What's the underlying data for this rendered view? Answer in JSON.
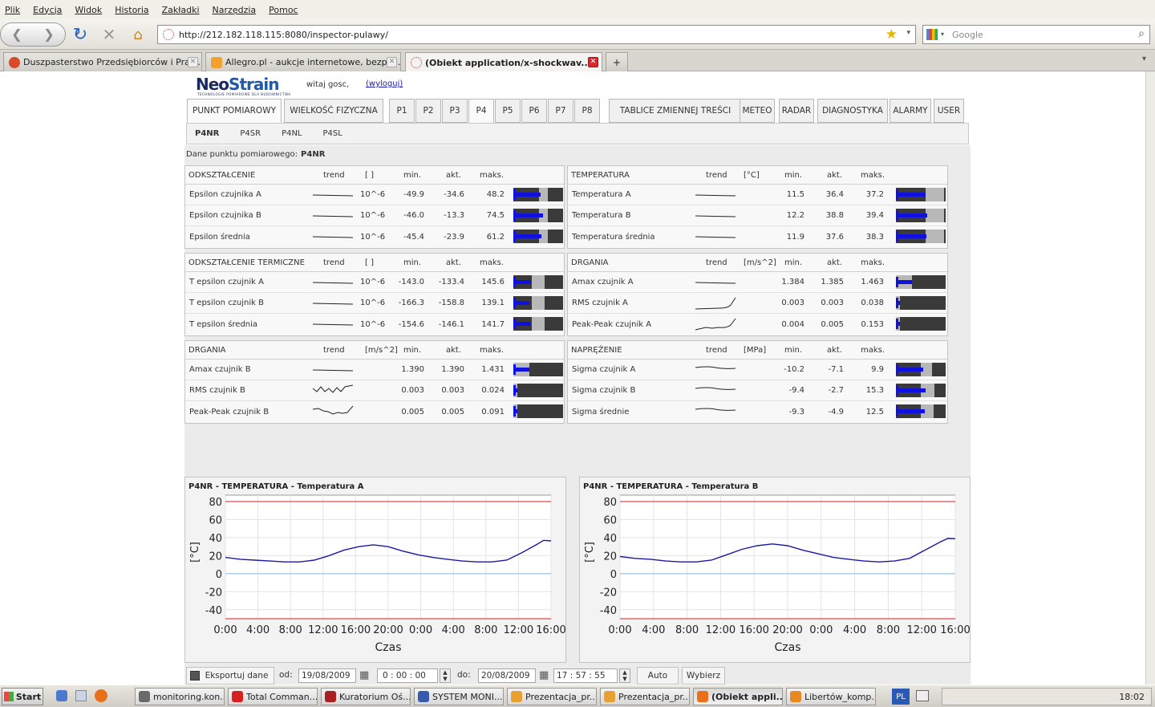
{
  "menu": [
    "Plik",
    "Edycja",
    "Widok",
    "Historia",
    "Zakładki",
    "Narzędzia",
    "Pomoc"
  ],
  "browser": {
    "url": "http://212.182.118.115:8080/inspector-pulawy/",
    "search_placeholder": "Google",
    "tabs": [
      {
        "label": "Duszpasterstwo Przedsiębiorców i Prac...",
        "active": false
      },
      {
        "label": "Allegro.pl - aukcje internetowe, bezpie...",
        "active": false
      },
      {
        "label": "(Obiekt application/x-shockwav...",
        "active": true
      }
    ]
  },
  "app": {
    "logo_neo": "Neo",
    "logo_strain": "Strain",
    "logo_sub": "TECHNOLOGIE POMIAROWE DLA BUDOWNICTWA",
    "greeting": "witaj gosc,",
    "logout": "(wyloguj)",
    "main_tabs": [
      {
        "label": "PUNKT POMIAROWY",
        "sel": true
      },
      {
        "label": "WIELKOŚĆ FIZYCZNA"
      },
      {
        "label": "P1"
      },
      {
        "label": "P2"
      },
      {
        "label": "P3"
      },
      {
        "label": "P4",
        "sel": true
      },
      {
        "label": "P5"
      },
      {
        "label": "P6"
      },
      {
        "label": "P7"
      },
      {
        "label": "P8"
      },
      {
        "label": "TABLICE ZMIENNEJ TREŚCI"
      },
      {
        "label": "METEO"
      },
      {
        "label": "RADAR"
      },
      {
        "label": "DIAGNOSTYKA"
      },
      {
        "label": "ALARMY"
      },
      {
        "label": "USER"
      }
    ],
    "sub_tabs": [
      {
        "label": "P4NR",
        "sel": true
      },
      {
        "label": "P4SR"
      },
      {
        "label": "P4NL"
      },
      {
        "label": "P4SL"
      }
    ],
    "point_label": "Dane punktu pomiarowego:",
    "point_name": "P4NR"
  },
  "panels": [
    {
      "title": "ODKSZTAŁCENIE",
      "trend": "trend",
      "unit": "[ ]",
      "min": "min.",
      "akt": "akt.",
      "maks": "maks.",
      "rows": [
        {
          "name": "Epsilon czujnika A",
          "unit": "10^-6",
          "min": "-49.9",
          "akt": "-34.6",
          "maks": "48.2",
          "range": [
            0.52,
            0.7
          ],
          "value": 0.55,
          "trend": "flat"
        },
        {
          "name": "Epsilon czujnika B",
          "unit": "10^-6",
          "min": "-46.0",
          "akt": "-13.3",
          "maks": "74.5",
          "range": [
            0.52,
            0.7
          ],
          "value": 0.6,
          "trend": "flat"
        },
        {
          "name": "Epsilon średnia",
          "unit": "10^-6",
          "min": "-45.4",
          "akt": "-23.9",
          "maks": "61.2",
          "range": [
            0.52,
            0.7
          ],
          "value": 0.57,
          "trend": "flat"
        }
      ]
    },
    {
      "title": "TEMPERATURA",
      "trend": "trend",
      "unit": "[°C]",
      "min": "min.",
      "akt": "akt.",
      "maks": "maks.",
      "rows": [
        {
          "name": "Temperatura A",
          "unit": "",
          "min": "11.5",
          "akt": "36.4",
          "maks": "37.2",
          "range": [
            0.6,
            0.97
          ],
          "value": 0.6,
          "trend": "flat"
        },
        {
          "name": "Temperatura B",
          "unit": "",
          "min": "12.2",
          "akt": "38.8",
          "maks": "39.4",
          "range": [
            0.6,
            0.97
          ],
          "value": 0.63,
          "trend": "flat"
        },
        {
          "name": "Temperatura średnia",
          "unit": "",
          "min": "11.9",
          "akt": "37.6",
          "maks": "38.3",
          "range": [
            0.6,
            0.97
          ],
          "value": 0.62,
          "trend": "flat"
        }
      ]
    },
    {
      "title": "ODKSZTAŁCENIE TERMICZNE",
      "trend": "trend",
      "unit": "[ ]",
      "min": "min.",
      "akt": "akt.",
      "maks": "maks.",
      "rows": [
        {
          "name": "T epsilon czujnik A",
          "unit": "10^-6",
          "min": "-143.0",
          "akt": "-133.4",
          "maks": "145.6",
          "range": [
            0.37,
            0.63
          ],
          "value": 0.36,
          "trend": "flat"
        },
        {
          "name": "T epsilon czujnik B",
          "unit": "10^-6",
          "min": "-166.3",
          "akt": "-158.8",
          "maks": "139.1",
          "range": [
            0.37,
            0.63
          ],
          "value": 0.32,
          "trend": "flat"
        },
        {
          "name": "T epsilon średnia",
          "unit": "10^-6",
          "min": "-154.6",
          "akt": "-146.1",
          "maks": "141.7",
          "range": [
            0.37,
            0.63
          ],
          "value": 0.34,
          "trend": "flat"
        }
      ]
    },
    {
      "title": "DRGANIA",
      "trend": "trend",
      "unit": "[m/s^2]",
      "min": "min.",
      "akt": "akt.",
      "maks": "maks.",
      "rows": [
        {
          "name": "Amax czujnik A",
          "unit": "",
          "min": "1.384",
          "akt": "1.385",
          "maks": "1.463",
          "range": [
            0,
            0.32
          ],
          "value": 0.32,
          "trend": "flat"
        },
        {
          "name": "RMS czujnik A",
          "unit": "",
          "min": "0.003",
          "akt": "0.003",
          "maks": "0.038",
          "range": [
            0,
            0.08
          ],
          "value": 0.08,
          "trend": "rise"
        },
        {
          "name": "Peak-Peak czujnik A",
          "unit": "",
          "min": "0.004",
          "akt": "0.005",
          "maks": "0.153",
          "range": [
            0,
            0.08
          ],
          "value": 0.08,
          "trend": "rise2"
        }
      ]
    },
    {
      "title": "DRGANIA",
      "trend": "trend",
      "unit": "[m/s^2]",
      "min": "min.",
      "akt": "akt.",
      "maks": "maks.",
      "rows": [
        {
          "name": "Amax czujnik B",
          "unit": "",
          "min": "1.390",
          "akt": "1.390",
          "maks": "1.431",
          "range": [
            0,
            0.32
          ],
          "value": 0.32,
          "trend": "flat"
        },
        {
          "name": "RMS czujnik B",
          "unit": "",
          "min": "0.003",
          "akt": "0.003",
          "maks": "0.024",
          "range": [
            0,
            0.08
          ],
          "value": 0.08,
          "trend": "zigzag"
        },
        {
          "name": "Peak-Peak czujnik B",
          "unit": "",
          "min": "0.005",
          "akt": "0.005",
          "maks": "0.091",
          "range": [
            0,
            0.08
          ],
          "value": 0.08,
          "trend": "wave"
        }
      ]
    },
    {
      "title": "NAPRĘŻENIE",
      "trend": "trend",
      "unit": "[MPa]",
      "min": "min.",
      "akt": "akt.",
      "maks": "maks.",
      "rows": [
        {
          "name": "Sigma czujnik A",
          "unit": "",
          "min": "-10.2",
          "akt": "-7.1",
          "maks": "9.9",
          "range": [
            0.5,
            0.72
          ],
          "value": 0.55,
          "trend": "flatish"
        },
        {
          "name": "Sigma czujnik B",
          "unit": "",
          "min": "-9.4",
          "akt": "-2.7",
          "maks": "15.3",
          "range": [
            0.5,
            0.78
          ],
          "value": 0.6,
          "trend": "flatish"
        },
        {
          "name": "Sigma średnie",
          "unit": "",
          "min": "-9.3",
          "akt": "-4.9",
          "maks": "12.5",
          "range": [
            0.5,
            0.75
          ],
          "value": 0.58,
          "trend": "flatish"
        }
      ]
    }
  ],
  "chart_data": [
    {
      "type": "line",
      "title": "P4NR - TEMPERATURA - Temperatura A",
      "xlabel": "Czas",
      "ylabel": "[°C]",
      "ylim": [
        -50,
        80
      ],
      "yticks": [
        80,
        60,
        40,
        20,
        0,
        -20,
        -40
      ],
      "xticks": [
        "0:00",
        "4:00",
        "8:00",
        "12:00",
        "16:00",
        "20:00",
        "0:00",
        "4:00",
        "8:00",
        "12:00",
        "16:00"
      ],
      "limits": [
        80,
        -50
      ],
      "x": [
        0,
        2,
        4,
        6,
        8,
        10,
        12,
        14,
        16,
        18,
        20,
        22,
        24,
        26,
        28,
        30,
        32,
        34,
        36,
        38,
        40,
        42
      ],
      "series": [
        {
          "values": [
            18,
            16,
            15,
            14,
            13,
            13,
            15,
            20,
            26,
            30,
            32,
            30,
            25,
            21,
            18,
            16,
            14,
            13,
            13,
            15,
            23,
            32
          ]
        }
      ],
      "extra_end": [
        37,
        36.4
      ]
    },
    {
      "type": "line",
      "title": "P4NR - TEMPERATURA - Temperatura B",
      "xlabel": "Czas",
      "ylabel": "[°C]",
      "ylim": [
        -50,
        80
      ],
      "yticks": [
        80,
        60,
        40,
        20,
        0,
        -20,
        -40
      ],
      "xticks": [
        "0:00",
        "4:00",
        "8:00",
        "12:00",
        "16:00",
        "20:00",
        "0:00",
        "4:00",
        "8:00",
        "12:00",
        "16:00"
      ],
      "limits": [
        80,
        -50
      ],
      "x": [
        0,
        2,
        4,
        6,
        8,
        10,
        12,
        14,
        16,
        18,
        20,
        22,
        24,
        26,
        28,
        30,
        32,
        34,
        36,
        38,
        40,
        42
      ],
      "series": [
        {
          "values": [
            19,
            17,
            16,
            14,
            13,
            13,
            15,
            21,
            27,
            31,
            33,
            31,
            26,
            22,
            18,
            16,
            14,
            13,
            14,
            17,
            26,
            35
          ]
        }
      ],
      "extra_end": [
        39,
        38.8
      ]
    }
  ],
  "bottom": {
    "export": "Eksportuj dane",
    "from_label": "od:",
    "from_date": "19/08/2009",
    "from_time": "0 : 00 : 00",
    "to_label": "do:",
    "to_date": "20/08/2009",
    "to_time": "17 : 57 : 55",
    "auto": "Auto",
    "choose": "Wybierz"
  },
  "taskbar": {
    "start": "Start",
    "buttons": [
      "monitoring.kon...",
      "Total Comman...",
      "Kuratorium Oś...",
      "SYSTEM MONI...",
      "Prezentacja_pr...",
      "Prezentacja_pr...",
      "(Obiekt appli...",
      "Libertów_komp..."
    ],
    "lang": "PL",
    "clock": "18:02"
  }
}
